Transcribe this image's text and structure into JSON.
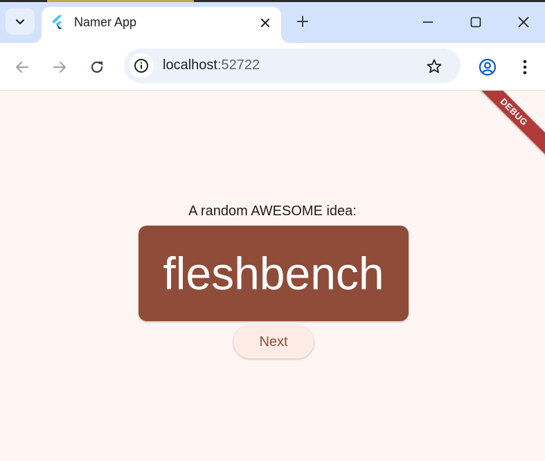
{
  "browser": {
    "tab": {
      "title": "Namer App"
    },
    "address_bar": {
      "host": "localhost",
      "port": ":52722"
    }
  },
  "icons": [
    "tab-search-icon",
    "flutter-favicon",
    "close-icon",
    "plus-icon",
    "minimize-icon",
    "maximize-icon",
    "window-close-icon",
    "back-arrow-icon",
    "forward-arrow-icon",
    "reload-icon",
    "info-icon",
    "star-icon",
    "profile-icon",
    "more-vert-icon"
  ],
  "app": {
    "debug_banner": "DEBUG",
    "headline": "A random AWESOME idea:",
    "idea": "fleshbench",
    "next_label": "Next"
  },
  "colors": {
    "primary": "#8f4c38",
    "background": "#fff6f4",
    "button_bg": "#fdece6",
    "debug_banner": "#b03b38",
    "tabstrip": "#d3e3fd"
  }
}
